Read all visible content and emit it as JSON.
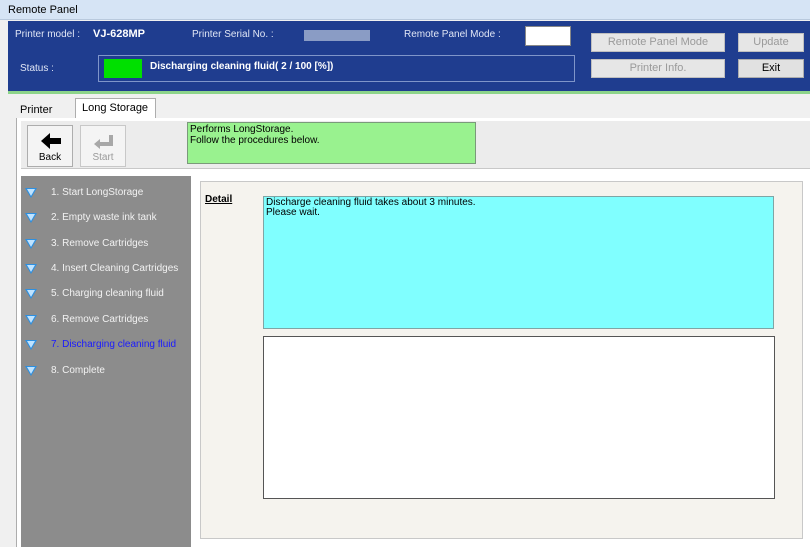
{
  "window": {
    "title": "Remote Panel"
  },
  "header": {
    "printer_model_label": "Printer model :",
    "printer_model_value": "VJ-628MP",
    "serial_label": "Printer Serial No. :",
    "remote_mode_label": "Remote Panel Mode :",
    "status_label": "Status :",
    "status_text": "Discharging cleaning fluid( 2 / 100 [%])"
  },
  "buttons": {
    "remote_panel_mode": "Remote Panel Mode",
    "update": "Update",
    "printer_info": "Printer Info.",
    "exit": "Exit"
  },
  "tabs": [
    {
      "label": "Printer Status"
    },
    {
      "label": "Long Storage"
    }
  ],
  "toolbar": {
    "back_label": "Back",
    "start_label": "Start"
  },
  "message": "Performs LongStorage.\nFollow the procedures below.",
  "steps": [
    {
      "label": "1. Start LongStorage"
    },
    {
      "label": "2. Empty waste ink tank"
    },
    {
      "label": "3. Remove Cartridges"
    },
    {
      "label": "4. Insert Cleaning Cartridges"
    },
    {
      "label": "5. Charging cleaning fluid"
    },
    {
      "label": "6. Remove Cartridges"
    },
    {
      "label": "7. Discharging cleaning fluid"
    },
    {
      "label": "8. Complete"
    }
  ],
  "detail": {
    "label": "Detail",
    "text": "Discharge cleaning fluid takes about 3 minutes.\nPlease wait."
  },
  "colors": {
    "status_led": "#00e000",
    "message_bg": "#99f28f",
    "detail_bg": "#80ffff",
    "current_step": "#1a1aff"
  },
  "icons": {
    "back": "arrow-left-icon",
    "start": "enter-return-icon"
  },
  "status": {
    "progress_percent": 2
  }
}
